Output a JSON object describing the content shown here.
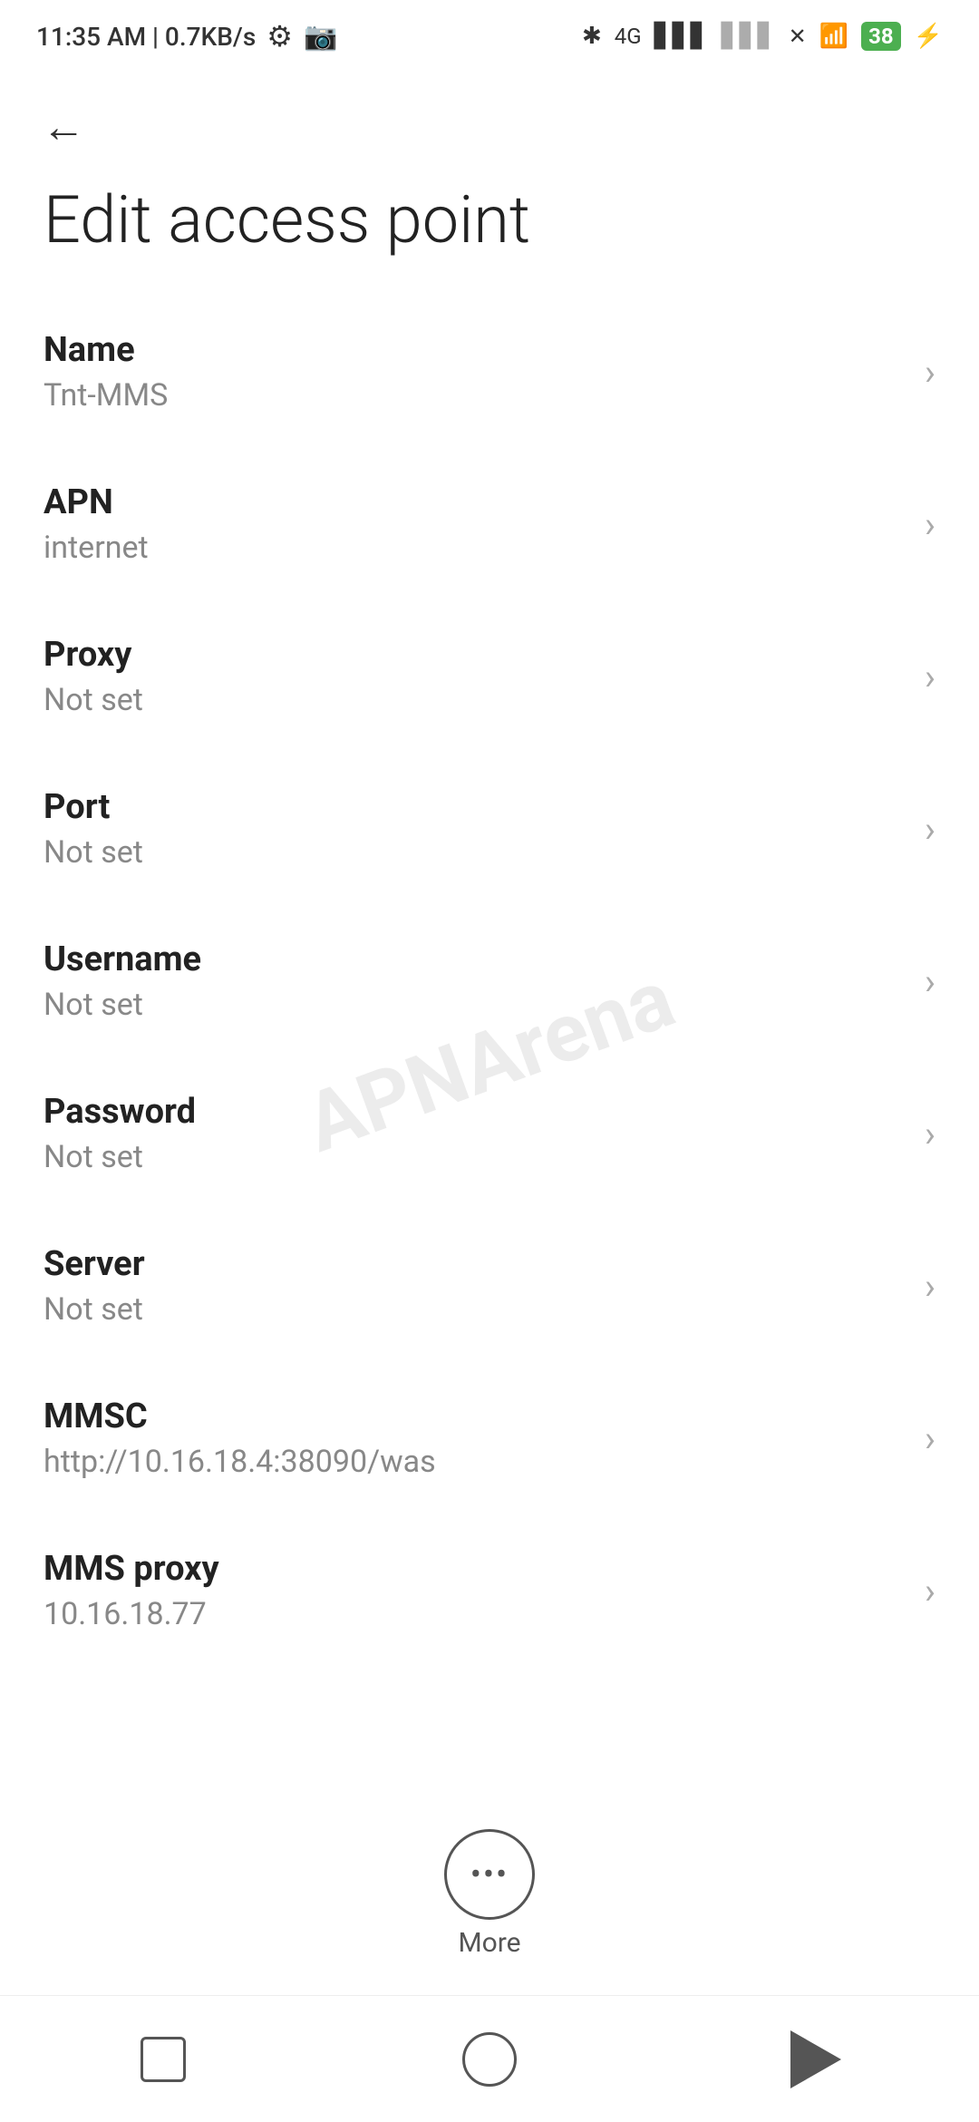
{
  "status_bar": {
    "time": "11:35 AM | 0.7KB/s",
    "battery_level": "38"
  },
  "header": {
    "back_label": "←",
    "title": "Edit access point"
  },
  "settings": {
    "items": [
      {
        "label": "Name",
        "value": "Tnt-MMS"
      },
      {
        "label": "APN",
        "value": "internet"
      },
      {
        "label": "Proxy",
        "value": "Not set"
      },
      {
        "label": "Port",
        "value": "Not set"
      },
      {
        "label": "Username",
        "value": "Not set"
      },
      {
        "label": "Password",
        "value": "Not set"
      },
      {
        "label": "Server",
        "value": "Not set"
      },
      {
        "label": "MMSC",
        "value": "http://10.16.18.4:38090/was"
      },
      {
        "label": "MMS proxy",
        "value": "10.16.18.77"
      }
    ]
  },
  "more_button": {
    "label": "More"
  },
  "watermark": "APNArena",
  "bottom_nav": {
    "square_label": "recent-apps",
    "circle_label": "home",
    "triangle_label": "back"
  }
}
